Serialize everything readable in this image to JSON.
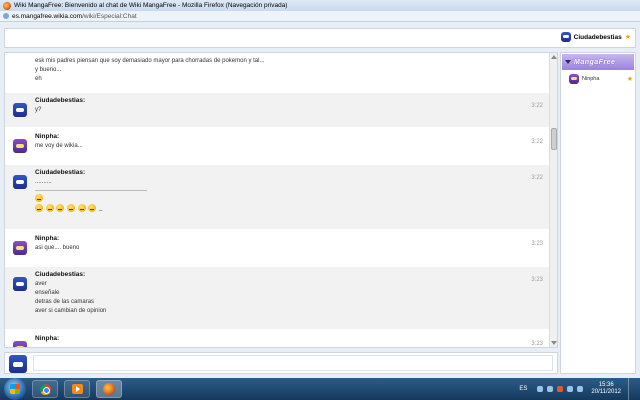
{
  "window": {
    "title": "Wiki MangaFree: Bienvenido al chat de Wiki MangaFree - Mozilla Firefox (Navegación privada)",
    "url_host": "es.mangafree.wikia.com",
    "url_path": "/wiki/Especial:Chat"
  },
  "header": {
    "current_user": "Ciudadebestias"
  },
  "messages": [
    {
      "user": "",
      "time": "",
      "lines": [
        "esk mis padres piensan que soy demasiado mayor para chorradas de pokemon y tal...",
        "y bueno...",
        "eh"
      ]
    },
    {
      "user": "Ciudadebestias:",
      "time": "3:22",
      "lines": [
        "y?"
      ]
    },
    {
      "user": "Ninpha:",
      "time": "3:22",
      "lines": [
        "me voy de wikia..."
      ]
    },
    {
      "user": "Ciudadebestias:",
      "time": "3:22",
      "lines": [
        "..........",
        "_"
      ]
    },
    {
      "user": "Ninpha:",
      "time": "3:23",
      "lines": [
        "asi que.... bueno"
      ]
    },
    {
      "user": "Ciudadebestias:",
      "time": "3:23",
      "lines": [
        "aver",
        "enseñale",
        "detras de las camaras",
        "aver si cambian de opinion"
      ]
    },
    {
      "user": "Ninpha:",
      "time": "3:23",
      "lines": []
    }
  ],
  "sidebar": {
    "room_name": "MangaFree",
    "users": [
      {
        "name": "Ninpha"
      }
    ]
  },
  "taskbar": {
    "language": "ES",
    "time": "15:36",
    "date": "20/11/2012"
  },
  "icons": [
    "firefox-icon",
    "globe-icon",
    "star-icon",
    "avatar",
    "windows-start-icon",
    "chrome-icon",
    "media-player-icon",
    "emoticon-icon"
  ]
}
